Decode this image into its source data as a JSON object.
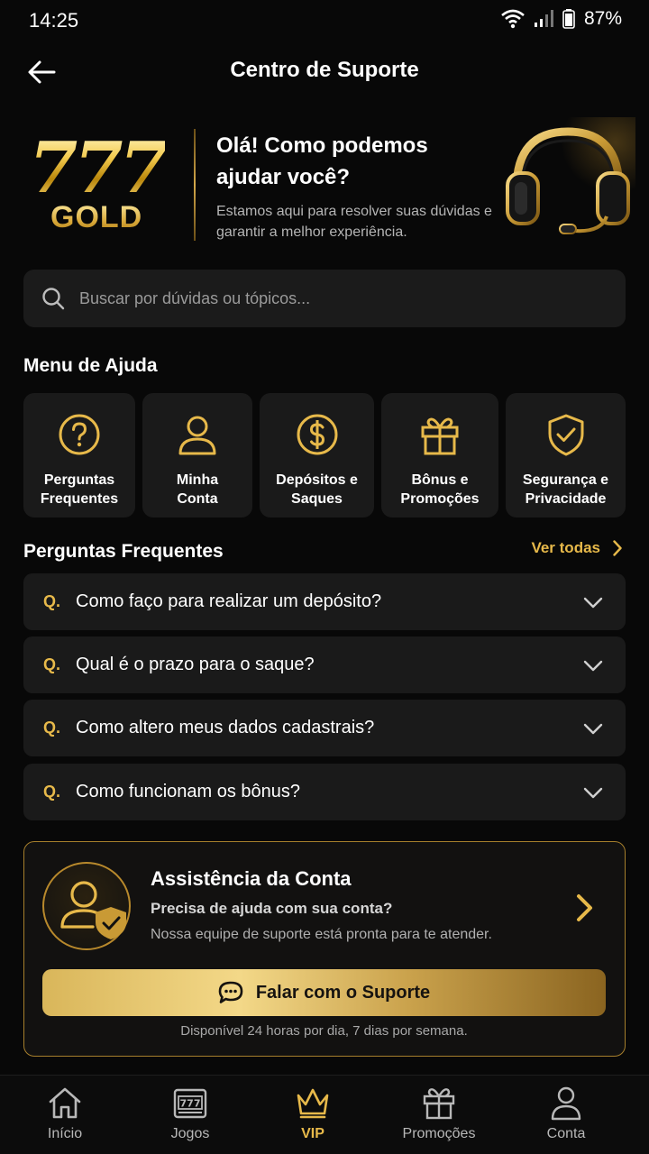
{
  "status_bar": {
    "time": "14:25",
    "battery": "87%"
  },
  "header": {
    "title": "Centro de Suporte",
    "back_icon": "arrow-left-icon"
  },
  "hero": {
    "logo_number": "777",
    "logo_word": "GOLD",
    "title": "Olá! Como podemos ajudar você?",
    "subtitle": "Estamos aqui para resolver suas dúvidas e garantir a melhor experiência."
  },
  "search": {
    "placeholder": "Buscar por dúvidas ou tópicos...",
    "value": ""
  },
  "help_menu": {
    "title": "Menu de Ajuda",
    "items": [
      {
        "label": "Perguntas Frequentes",
        "icon": "question-circle-icon"
      },
      {
        "label": "Minha Conta",
        "icon": "user-icon"
      },
      {
        "label": "Depósitos e Saques",
        "icon": "dollar-circle-icon"
      },
      {
        "label": "Bônus e Promoções",
        "icon": "gift-icon"
      },
      {
        "label": "Segurança e Privacidade",
        "icon": "shield-check-icon"
      }
    ]
  },
  "faq": {
    "title": "Perguntas Frequentes",
    "see_all": "Ver todas",
    "q_marker": "Q.",
    "items": [
      {
        "question": "Como faço para realizar um depósito?"
      },
      {
        "question": "Qual é o prazo para o saque?"
      },
      {
        "question": "Como altero meus dados cadastrais?"
      },
      {
        "question": "Como funcionam os bônus?"
      }
    ]
  },
  "assistance": {
    "title": "Assistência da Conta",
    "subtitle": "Precisa de ajuda com sua conta?",
    "description": "Nossa equipe de suporte está pronta para te atender.",
    "button_label": "Falar com o Suporte",
    "availability": "Disponível 24 horas por dia, 7 dias por semana."
  },
  "bottom_nav": {
    "active": "VIP",
    "items": [
      {
        "label": "Início",
        "icon": "home-icon"
      },
      {
        "label": "Jogos",
        "icon": "slot-machine-icon"
      },
      {
        "label": "VIP",
        "icon": "crown-icon"
      },
      {
        "label": "Promoções",
        "icon": "gift-icon"
      },
      {
        "label": "Conta",
        "icon": "user-icon"
      }
    ]
  },
  "colors": {
    "accent_gold": "#e7b94a",
    "background": "#080808",
    "card": "#1a1a1a"
  }
}
